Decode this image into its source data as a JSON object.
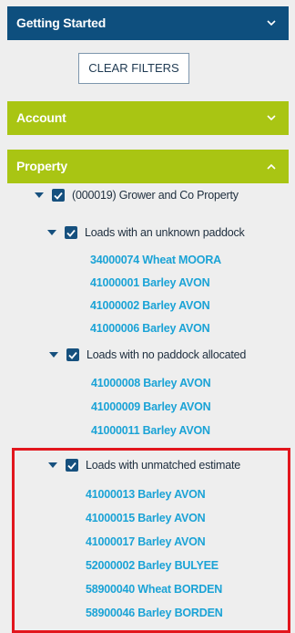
{
  "panels": {
    "getting_started": {
      "title": "Getting Started",
      "chevron": "chevron-down-icon"
    },
    "account": {
      "title": "Account",
      "chevron": "chevron-down-icon"
    },
    "property": {
      "title": "Property",
      "chevron": "chevron-up-icon"
    }
  },
  "clear_filters_label": "CLEAR FILTERS",
  "tree": {
    "property_node": {
      "label": "(000019) Grower and Co Property",
      "checked": true,
      "expanded": true
    },
    "groups": [
      {
        "label": "Loads with an unknown paddock",
        "checked": true,
        "expanded": true,
        "items": [
          "34000074 Wheat MOORA",
          "41000001 Barley AVON",
          "41000002 Barley AVON",
          "41000006 Barley AVON"
        ]
      },
      {
        "label": "Loads with no paddock allocated",
        "checked": true,
        "expanded": true,
        "items": [
          "41000008 Barley AVON",
          "41000009 Barley AVON",
          "41000011 Barley AVON"
        ]
      },
      {
        "label": "Loads with unmatched estimate",
        "checked": true,
        "expanded": true,
        "items": [
          "41000013 Barley AVON",
          "41000015 Barley AVON",
          "41000017 Barley AVON",
          "52000002 Barley BULYEE",
          "58900040 Wheat BORDEN",
          "58900046 Barley BORDEN"
        ]
      }
    ]
  },
  "colors": {
    "header_blue": "#0e4f7e",
    "header_green": "#a9c513",
    "link_blue": "#1ba3d6",
    "highlight_red": "#e2161d",
    "background": "#eeeeee"
  }
}
